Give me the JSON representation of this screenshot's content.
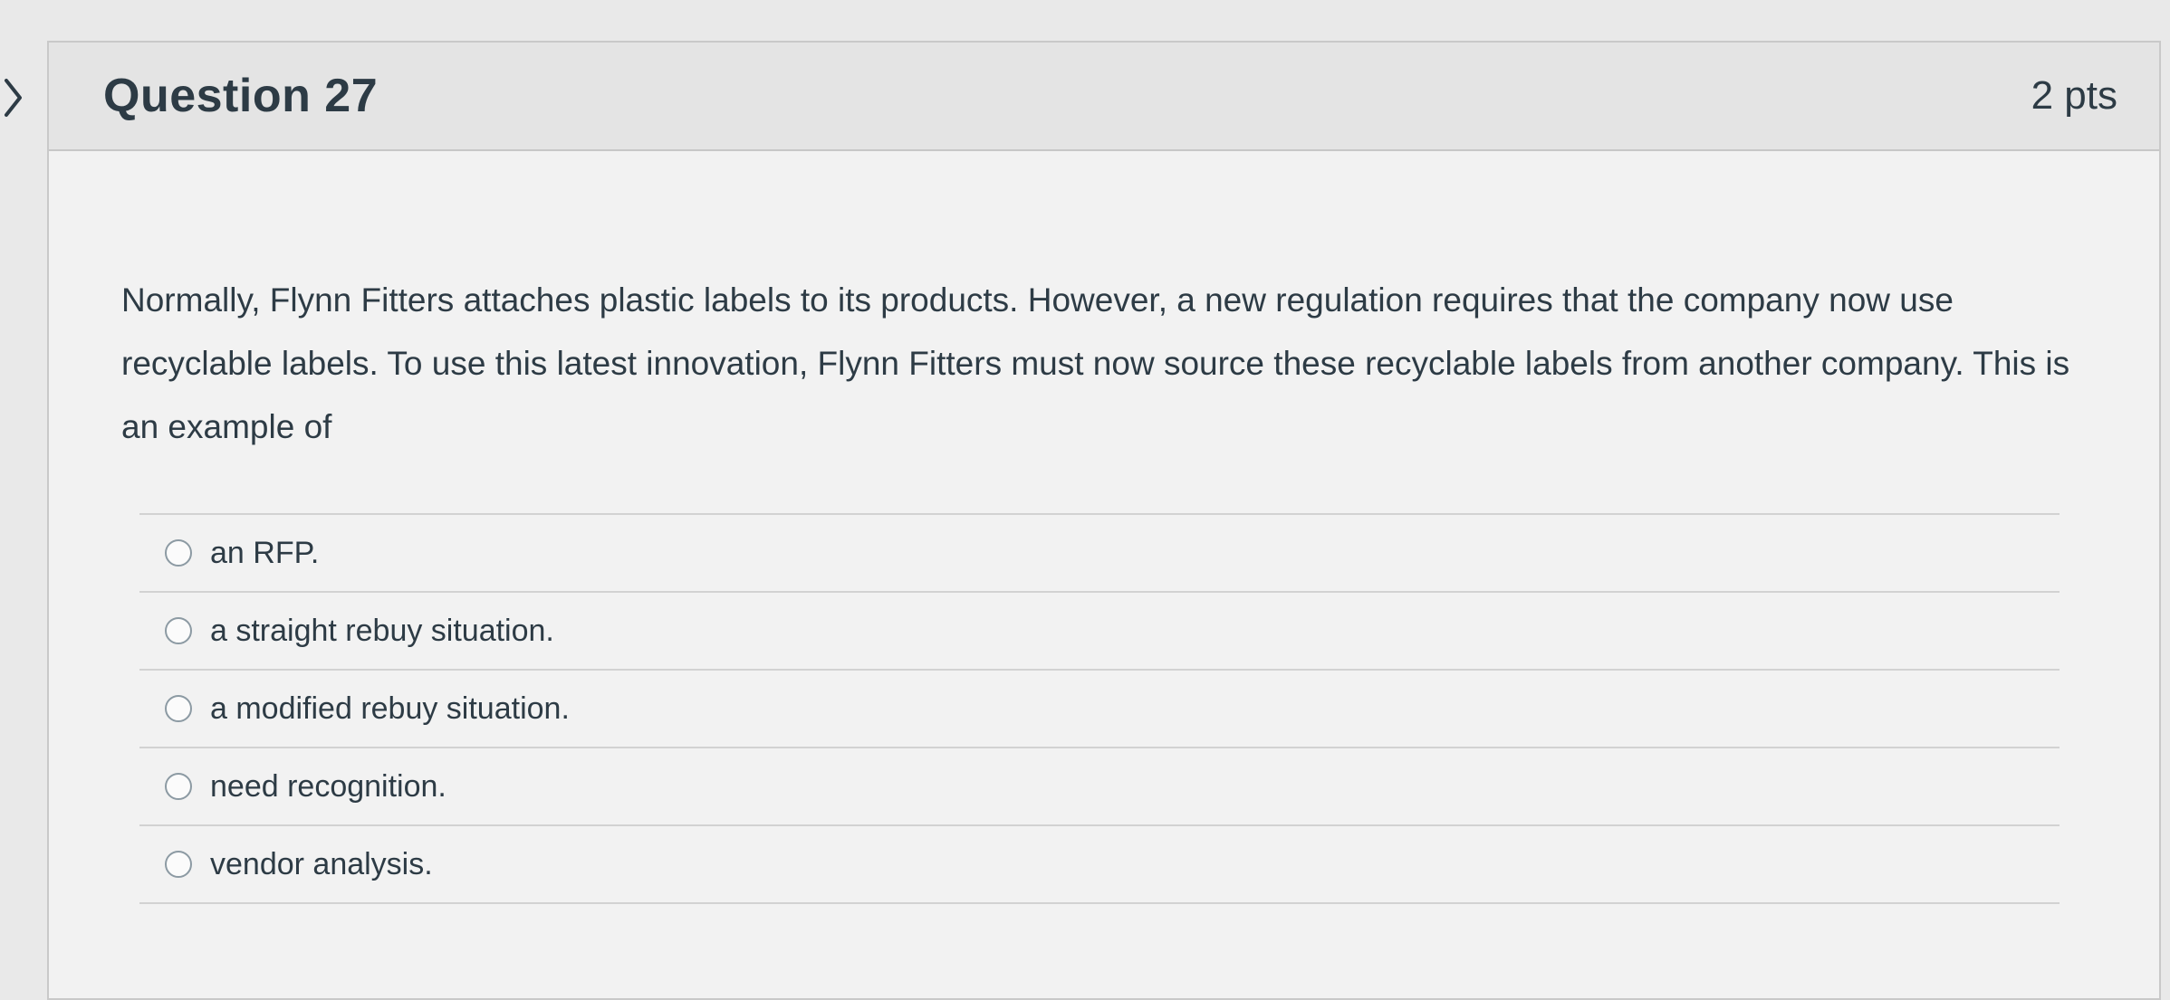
{
  "question": {
    "title": "Question 27",
    "points": "2 pts",
    "text": "Normally, Flynn Fitters attaches plastic labels to its products. However, a new regulation requires that the company now use recyclable labels. To use this latest innovation, Flynn Fitters must now source these recyclable labels from another company. This is an example of",
    "answers": [
      {
        "label": "an RFP."
      },
      {
        "label": "a straight rebuy situation."
      },
      {
        "label": "a modified rebuy situation."
      },
      {
        "label": "need recognition."
      },
      {
        "label": "vendor analysis."
      }
    ]
  },
  "icons": {
    "side_toggle": "chevron-right-icon",
    "answer_radio": "radio-icon"
  },
  "colors": {
    "text": "#2d3b45",
    "header_background": "#e4e4e4",
    "card_background": "#f2f2f2",
    "border": "#c9c9c9"
  }
}
